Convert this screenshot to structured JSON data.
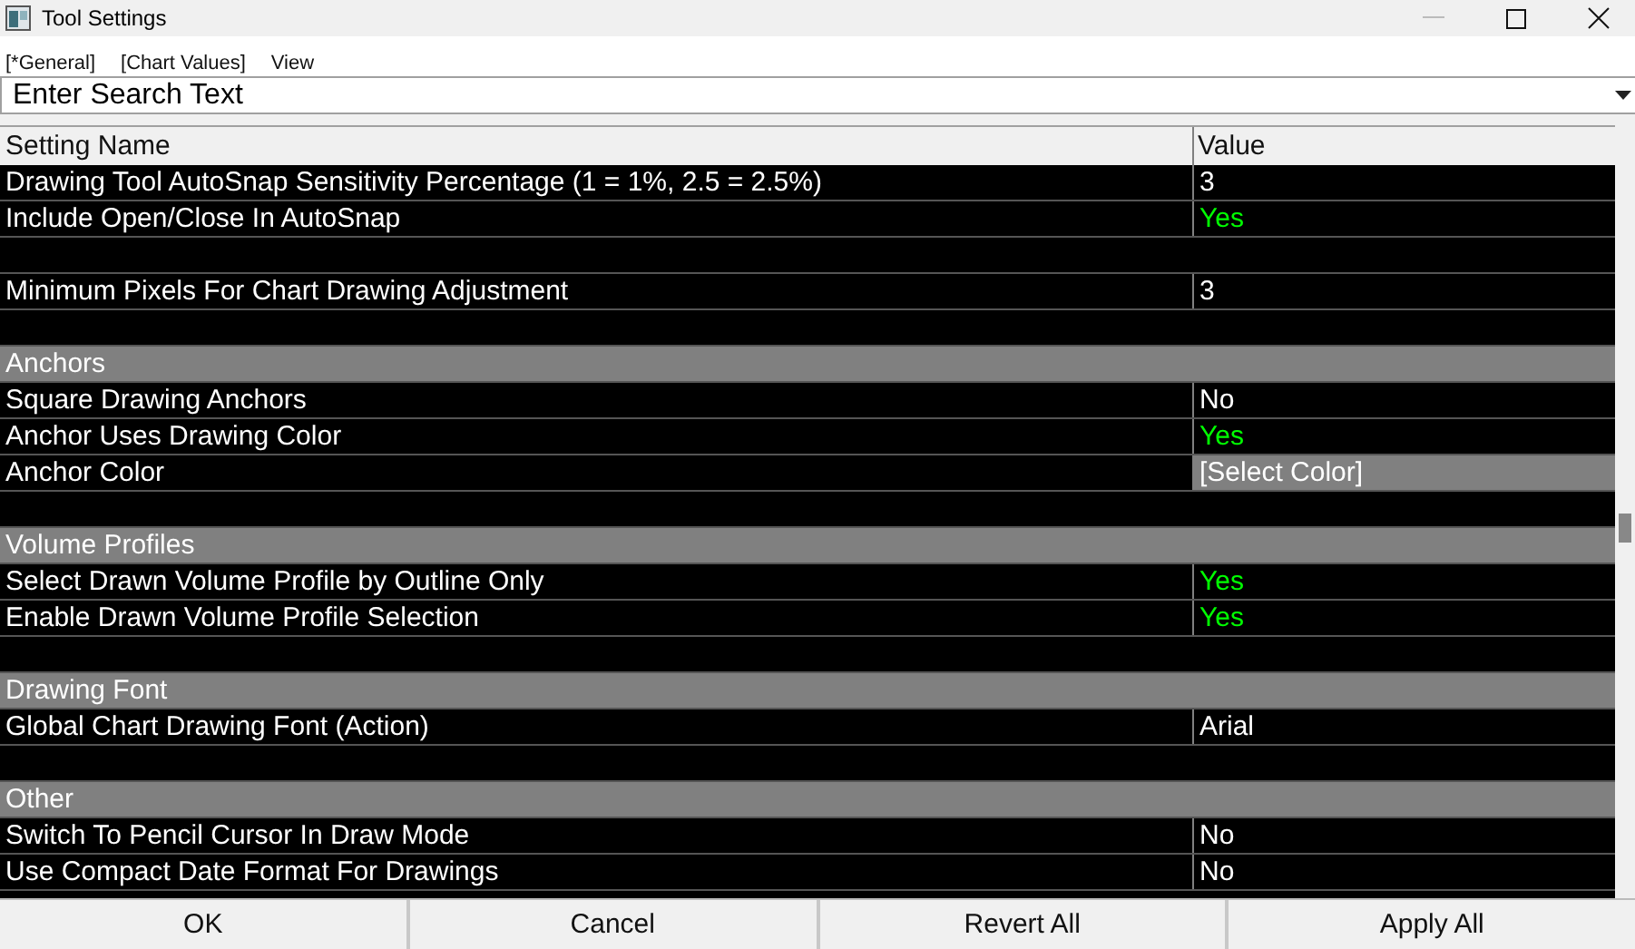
{
  "window": {
    "title": "Tool Settings"
  },
  "menu": [
    {
      "label": "[*General]"
    },
    {
      "label": "[Chart Values]"
    },
    {
      "label": "View"
    }
  ],
  "search": {
    "value": "Enter Search Text"
  },
  "table": {
    "columns": [
      "Setting Name",
      "Value"
    ],
    "rows": [
      {
        "kind": "setting",
        "name": "Drawing Tool AutoSnap Sensitivity Percentage (1 = 1%, 2.5 = 2.5%)",
        "value": "3",
        "color": "#ffffff"
      },
      {
        "kind": "setting",
        "name": "Include Open/Close In AutoSnap",
        "value": "Yes",
        "color": "#00ff00"
      },
      {
        "kind": "blank"
      },
      {
        "kind": "setting",
        "name": "Minimum Pixels For Chart Drawing Adjustment",
        "value": "3",
        "color": "#ffffff"
      },
      {
        "kind": "blank"
      },
      {
        "kind": "section",
        "name": "Anchors"
      },
      {
        "kind": "setting",
        "name": "Square Drawing Anchors",
        "value": "No",
        "color": "#ffffff"
      },
      {
        "kind": "setting",
        "name": "Anchor Uses Drawing Color",
        "value": "Yes",
        "color": "#00ff00"
      },
      {
        "kind": "color_setting",
        "name": "Anchor Color",
        "value": "[Select Color]",
        "color": "#ffffff"
      },
      {
        "kind": "blank"
      },
      {
        "kind": "section",
        "name": "Volume Profiles"
      },
      {
        "kind": "setting",
        "name": "Select Drawn Volume Profile by Outline Only",
        "value": "Yes",
        "color": "#00ff00"
      },
      {
        "kind": "setting",
        "name": "Enable Drawn Volume Profile Selection",
        "value": "Yes",
        "color": "#00ff00"
      },
      {
        "kind": "blank"
      },
      {
        "kind": "section",
        "name": "Drawing Font"
      },
      {
        "kind": "setting",
        "name": "Global Chart Drawing Font (Action)",
        "value": "Arial",
        "color": "#ffffff"
      },
      {
        "kind": "blank"
      },
      {
        "kind": "section",
        "name": "Other"
      },
      {
        "kind": "setting",
        "name": "Switch To Pencil Cursor In Draw Mode",
        "value": "No",
        "color": "#ffffff"
      },
      {
        "kind": "setting",
        "name": "Use Compact Date Format For Drawings",
        "value": "No",
        "color": "#ffffff"
      }
    ]
  },
  "buttons": [
    {
      "label": "OK"
    },
    {
      "label": "Cancel"
    },
    {
      "label": "Revert All"
    },
    {
      "label": "Apply All"
    }
  ]
}
